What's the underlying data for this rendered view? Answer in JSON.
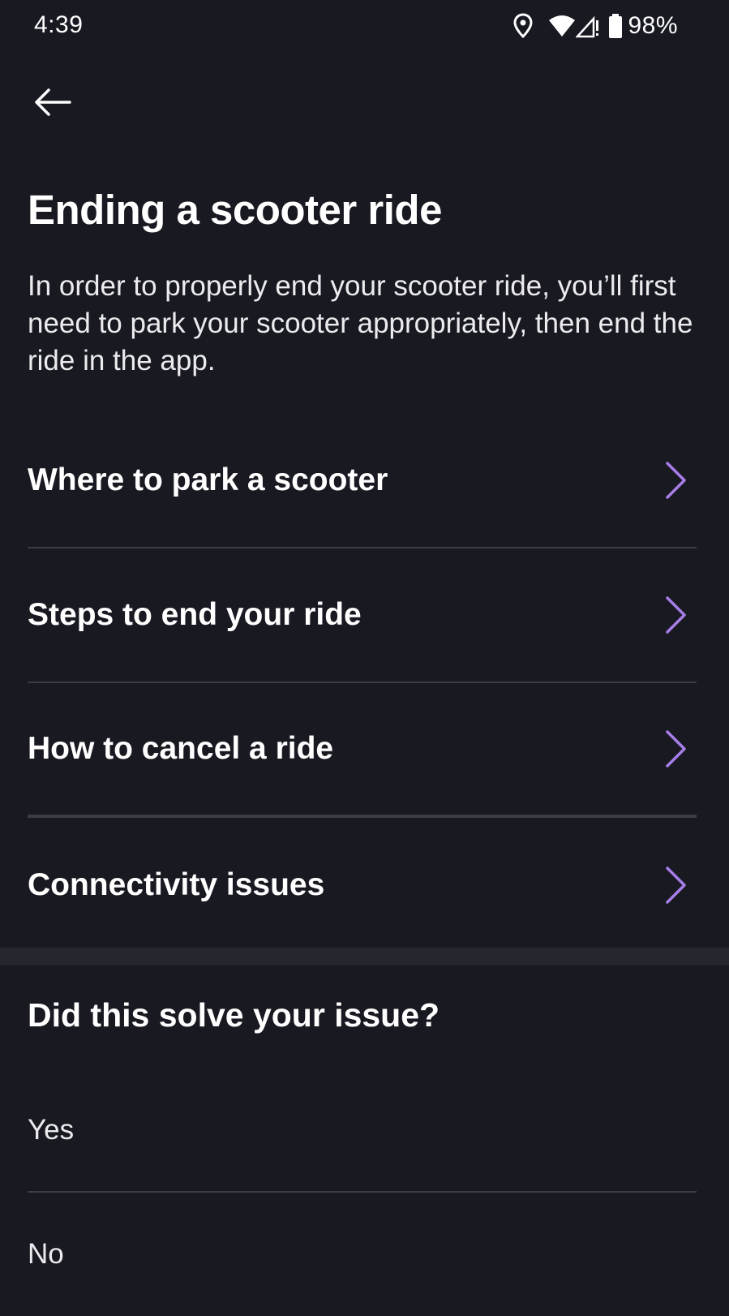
{
  "status_bar": {
    "time": "4:39",
    "battery_percent": "98%",
    "icons": [
      "location-icon",
      "wifi-icon",
      "signal-icon",
      "battery-icon"
    ]
  },
  "header": {
    "back_icon": "arrow-left-icon"
  },
  "article": {
    "title": "Ending a scooter ride",
    "intro": "In order to properly end your scooter ride, you’ll first need to park your scooter appropriately, then end the ride in the app."
  },
  "topics": [
    {
      "label": "Where to park a scooter"
    },
    {
      "label": "Steps to end your ride"
    },
    {
      "label": "How to cancel a ride"
    },
    {
      "label": "Connectivity issues"
    }
  ],
  "feedback": {
    "title": "Did this solve your issue?",
    "options": [
      {
        "label": "Yes"
      },
      {
        "label": "No"
      }
    ]
  },
  "colors": {
    "background": "#181921",
    "divider": "#3b3c44",
    "section_band": "#26272e",
    "accent_chevron": "#a77ee8",
    "text": "#ffffff"
  }
}
